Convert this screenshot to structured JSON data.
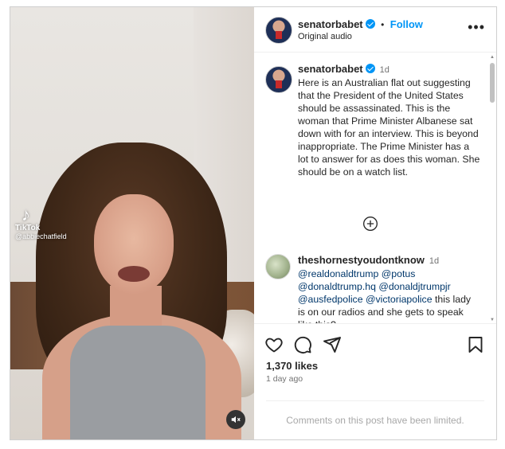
{
  "post": {
    "author": "senatorbabet",
    "follow_label": "Follow",
    "audio": "Original audio",
    "more_icon": "more-options-icon",
    "dot_separator": "•"
  },
  "video": {
    "watermark_logo": "TikTok",
    "watermark_handle": "@abbiechatfield",
    "mute_icon": "muted-speaker-icon"
  },
  "caption": {
    "author": "senatorbabet",
    "time": "1d",
    "text": "Here is an Australian flat out suggesting that the President of the United States should be assassinated. This is the woman that Prime Minister Albanese sat down with for an interview. This is beyond inappropriate. The Prime Minister has a lot to answer for as does this woman. She should be on a watch list."
  },
  "comments": [
    {
      "author": "theshornestyoudontknow",
      "time": "1d",
      "mentions": [
        "@realdonaldtrump",
        "@potus",
        "@donaldtrump.hq",
        "@donaldjtrumpjr",
        "@ausfedpolice",
        "@victoriapolice"
      ],
      "tail": "this lady is on our radios and she gets to speak like this?"
    }
  ],
  "stats": {
    "likes": "1,370 likes",
    "date": "1 day ago"
  },
  "footer": {
    "limited": "Comments on this post have been limited."
  },
  "colors": {
    "link_blue": "#0095f6",
    "mention_blue": "#00376b",
    "muted_gray": "#737373"
  }
}
